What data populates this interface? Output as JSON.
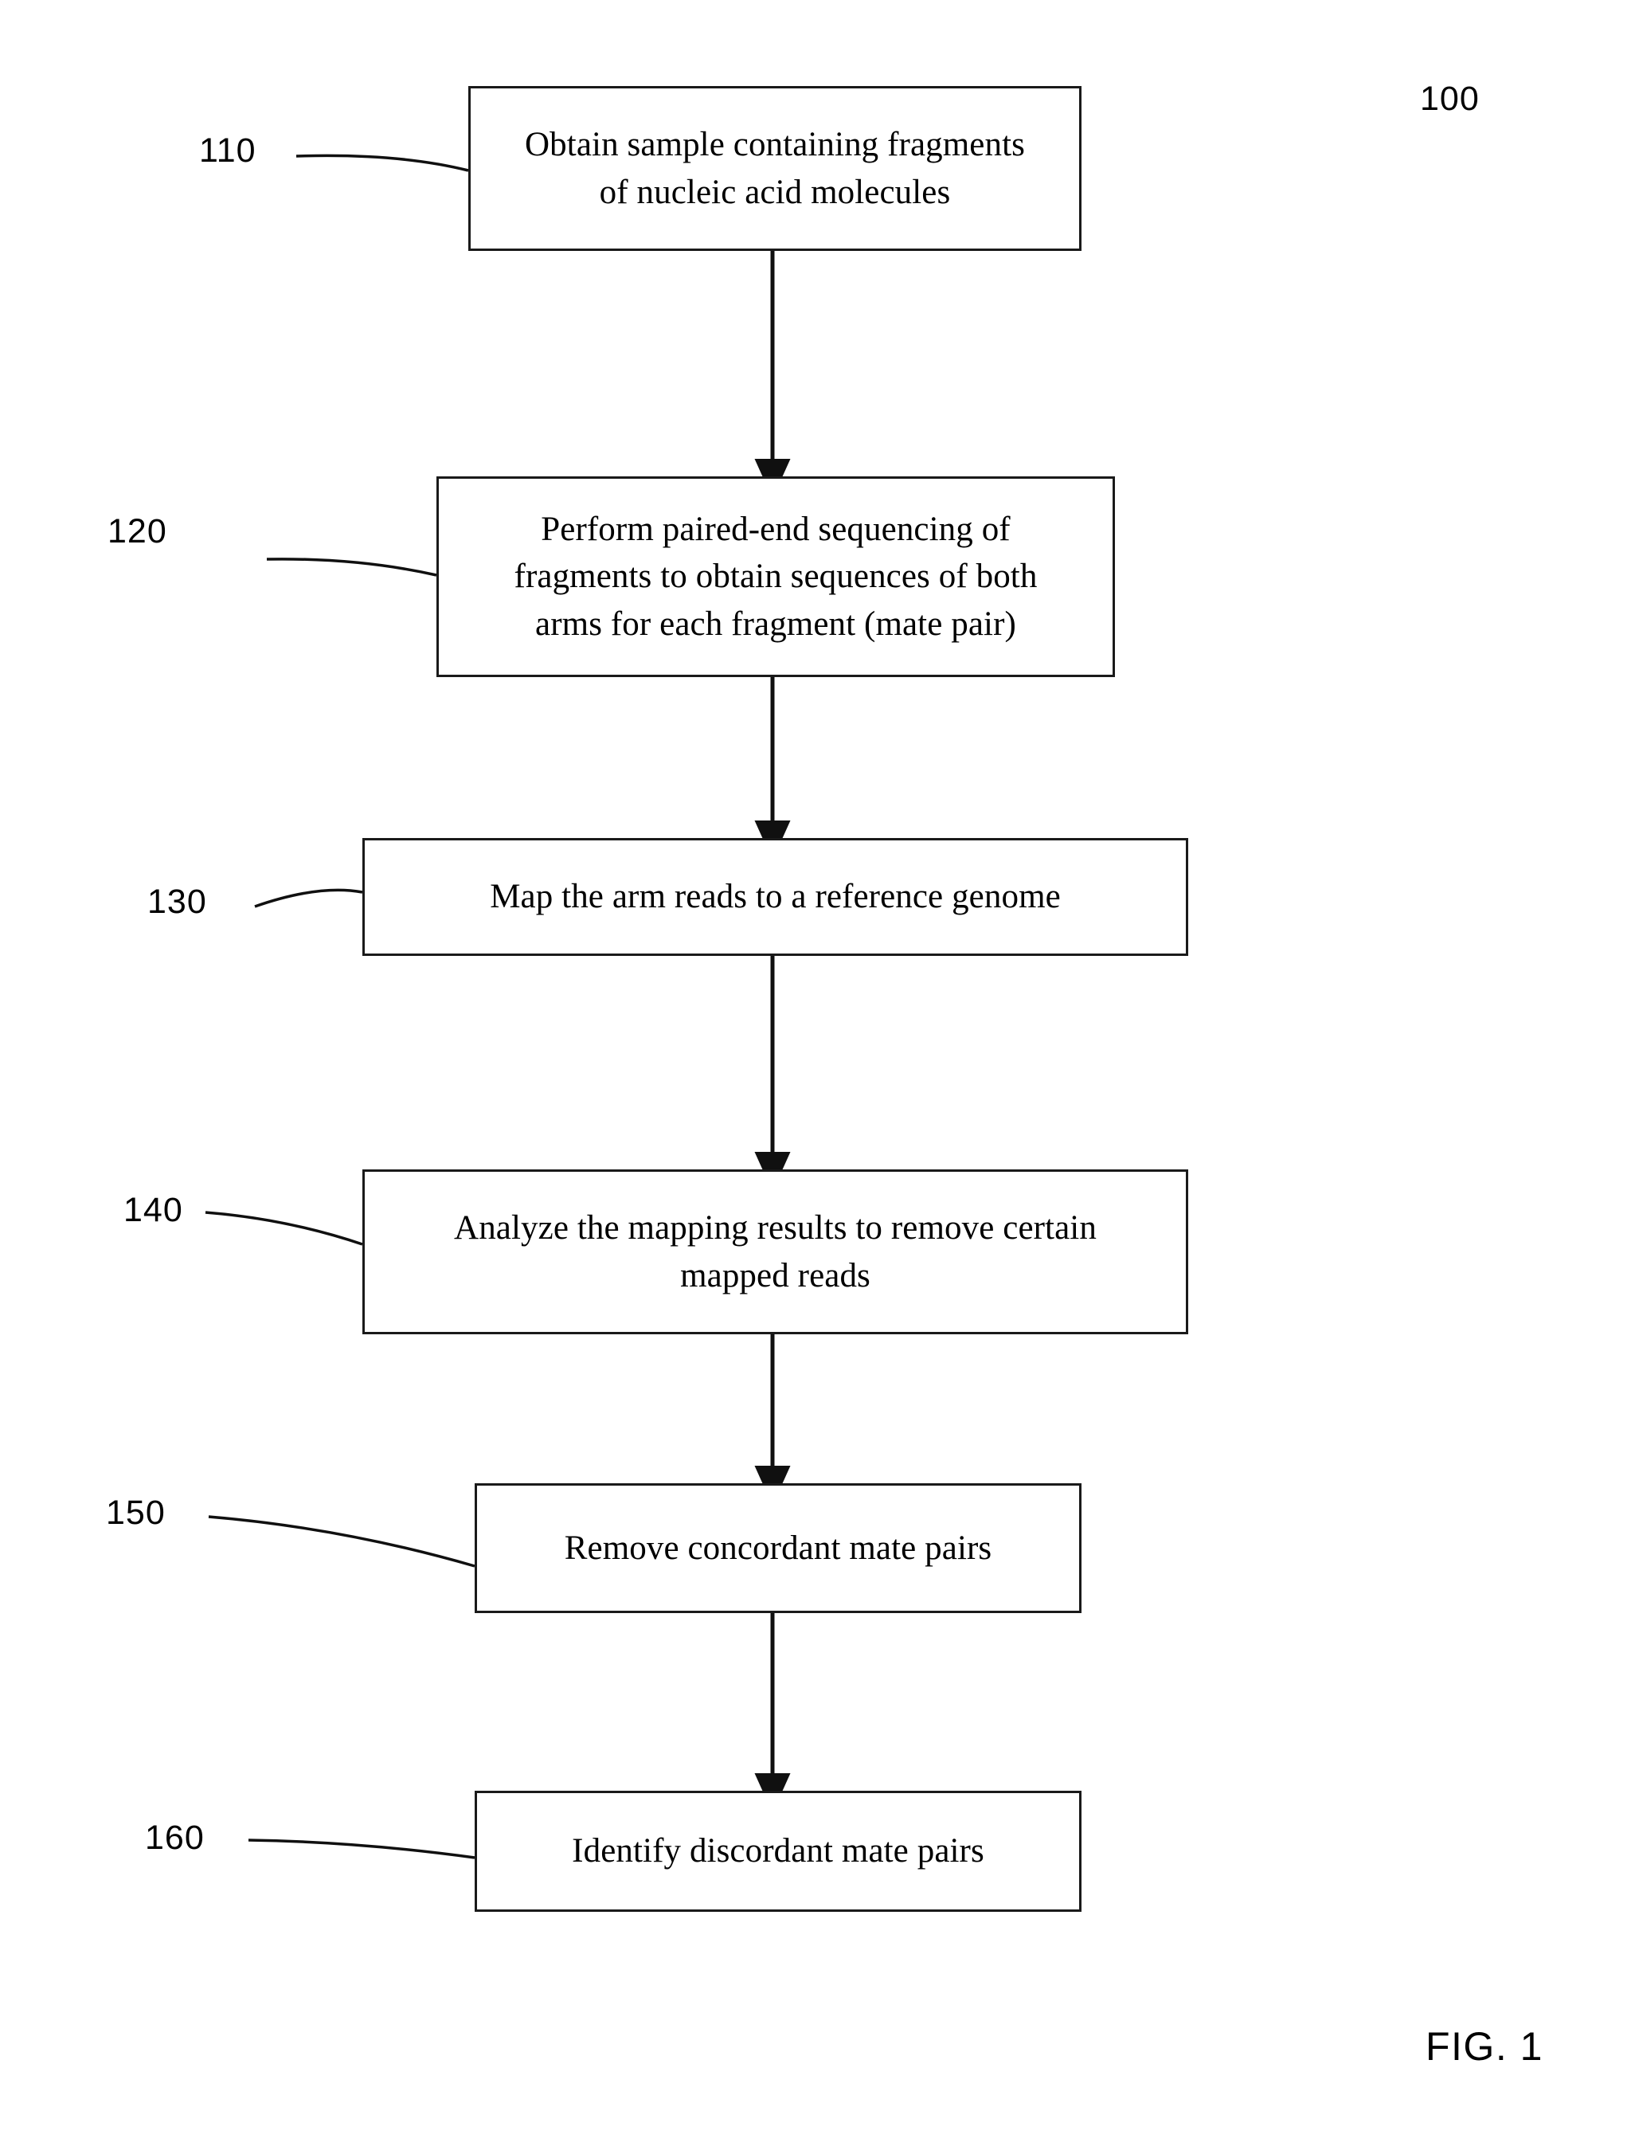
{
  "figure": {
    "label": "FIG. 1",
    "diagram_number": "100"
  },
  "flowchart": {
    "steps": [
      {
        "ref": "110",
        "text": "Obtain sample containing fragments\nof nucleic acid molecules"
      },
      {
        "ref": "120",
        "text": "Perform paired-end sequencing of\nfragments to obtain sequences of both\narms for each fragment (mate pair)"
      },
      {
        "ref": "130",
        "text": "Map the arm reads to a reference genome"
      },
      {
        "ref": "140",
        "text": "Analyze the mapping results to remove certain\nmapped reads"
      },
      {
        "ref": "150",
        "text": "Remove concordant mate pairs"
      },
      {
        "ref": "160",
        "text": "Identify discordant mate pairs"
      }
    ]
  },
  "colors": {
    "stroke": "#1a1a1a",
    "text": "#000000",
    "background": "#ffffff"
  }
}
